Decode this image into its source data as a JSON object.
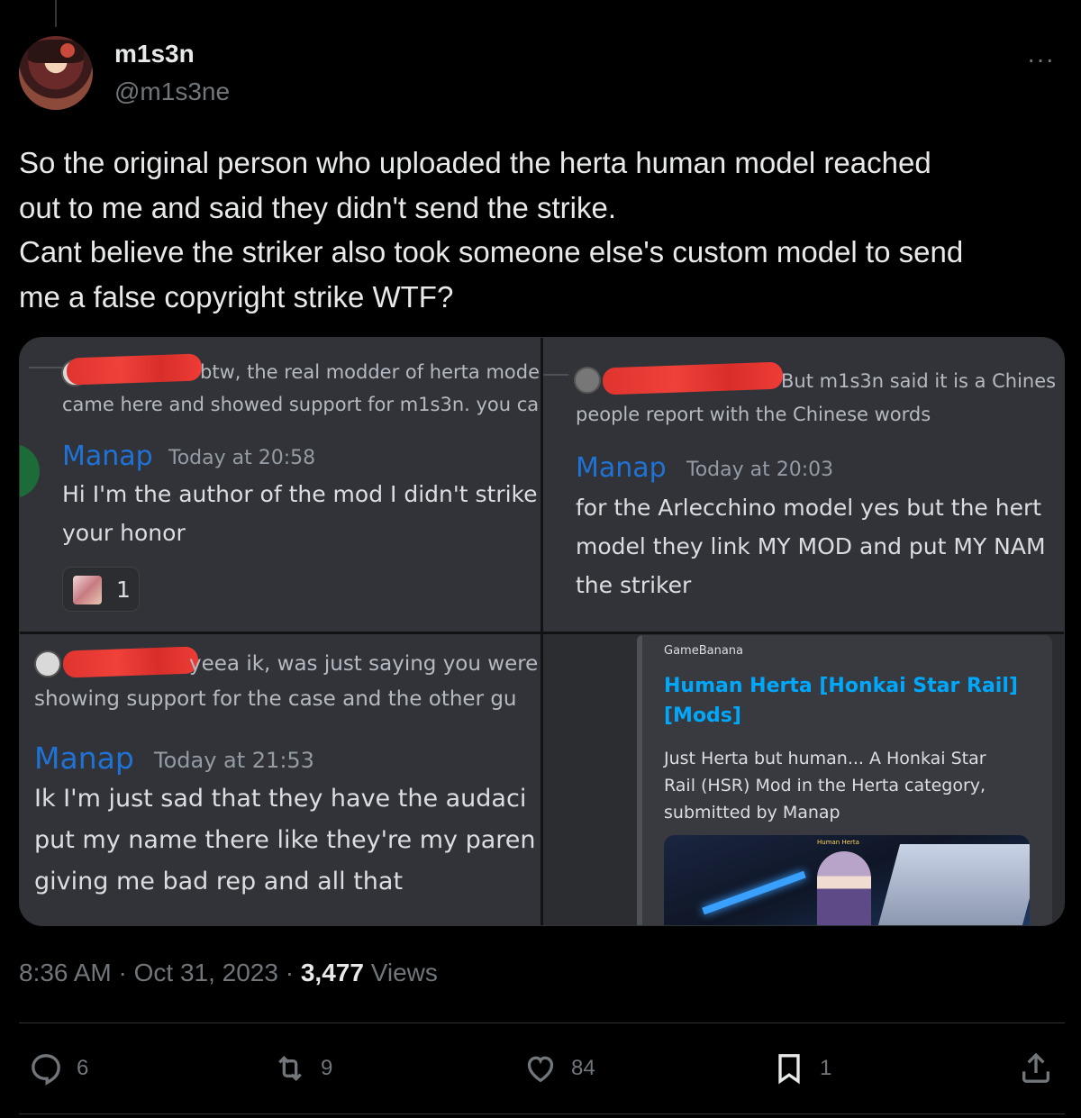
{
  "author": {
    "display_name": "m1s3n",
    "handle": "@m1s3ne"
  },
  "tweet": {
    "lines": [
      "So the original person who uploaded the herta human model reached",
      "out to me and said they didn't send the strike.",
      "Cant believe the striker also took someone else's custom model to send",
      "me a false copyright strike WTF?"
    ]
  },
  "media": {
    "panel1": {
      "quote_line1": "btw, the real modder of herta mode",
      "quote_line2": "came here and showed support for m1s3n. you ca",
      "author": "Manap",
      "timestamp": "Today at 20:58",
      "message": [
        "Hi I'm the author of the mod I didn't strike",
        "your honor"
      ],
      "reaction_count": "1"
    },
    "panel2": {
      "quote_line1": "But m1s3n said it is a Chines",
      "quote_line2": "people report with the Chinese words",
      "author": "Manap",
      "timestamp": "Today at 20:03",
      "message": [
        "for the Arlecchino model yes but the hert",
        "model they link MY MOD and put MY NAM",
        "the striker"
      ]
    },
    "panel3": {
      "quote_line1": "yeea ik, was just saying you were",
      "quote_line2": "showing support for the case and the other gu",
      "author": "Manap",
      "timestamp": "Today at 21:53",
      "message": [
        "Ik I'm just sad that they have the audaci",
        "put my name there like they're my paren",
        "giving me bad rep and all that"
      ]
    },
    "panel4": {
      "site": "GameBanana",
      "title": [
        "Human Herta [Honkai Star Rail]",
        "[Mods]"
      ],
      "description": [
        "Just Herta but human... A Honkai Star",
        "Rail (HSR) Mod in the Herta category,",
        "submitted by Manap"
      ],
      "image_caption": "Human Herta"
    }
  },
  "meta": {
    "time": "8:36 AM",
    "date": "Oct 31, 2023",
    "views_count": "3,477",
    "views_label": "Views"
  },
  "actions": {
    "replies": "6",
    "reposts": "9",
    "likes": "84",
    "bookmarks": "1"
  },
  "colors": {
    "background": "#000000",
    "text": "#e7e9ea",
    "muted": "#71767b",
    "discord_bg": "#313338",
    "discord_name": "#1f73d6",
    "link": "#00a8fc"
  }
}
